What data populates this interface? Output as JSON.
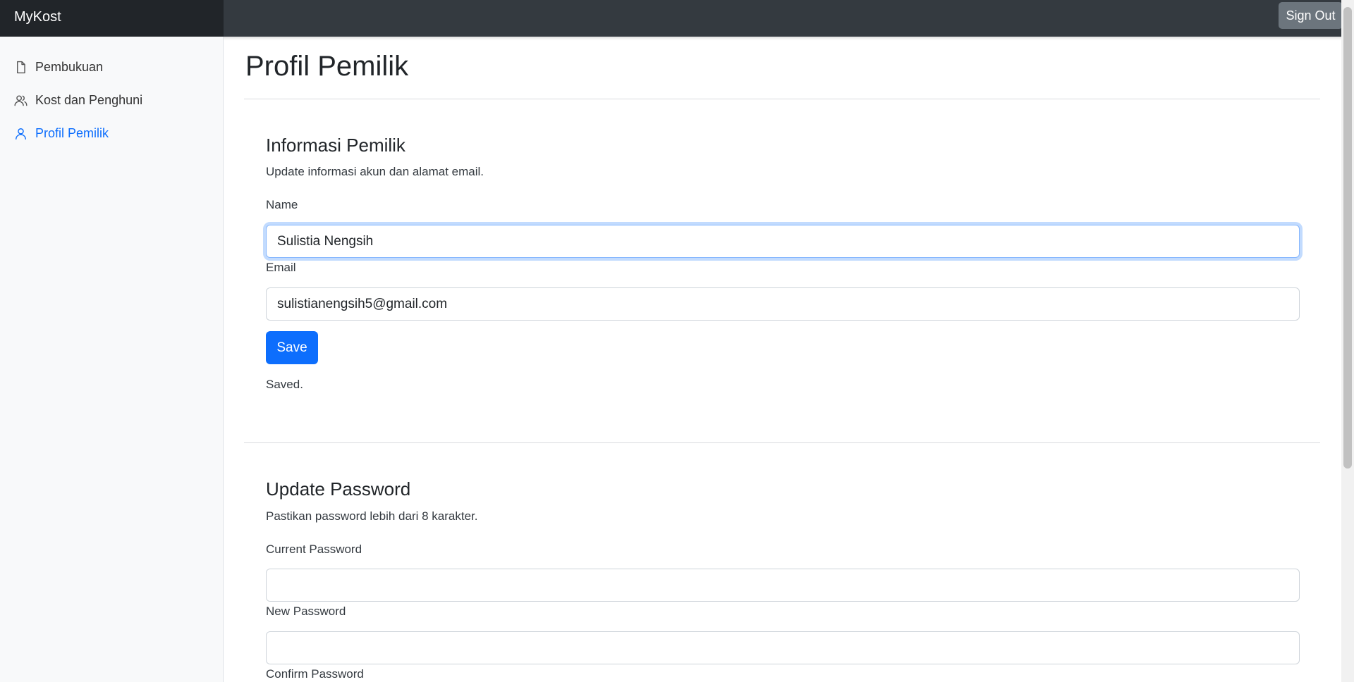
{
  "navbar": {
    "brand": "MyKost",
    "signout_label": "Sign Out"
  },
  "sidebar": {
    "items": [
      {
        "label": "Pembukuan",
        "icon": "file-icon",
        "active": false
      },
      {
        "label": "Kost dan Penghuni",
        "icon": "users-icon",
        "active": false
      },
      {
        "label": "Profil Pemilik",
        "icon": "user-icon",
        "active": true
      }
    ]
  },
  "main": {
    "title": "Profil Pemilik",
    "info": {
      "title": "Informasi Pemilik",
      "description": "Update informasi akun dan alamat email.",
      "name_label": "Name",
      "name_value": "Sulistia Nengsih",
      "email_label": "Email",
      "email_value": "sulistianengsih5@gmail.com",
      "save_label": "Save",
      "saved_message": "Saved."
    },
    "password": {
      "title": "Update Password",
      "description": "Pastikan password lebih dari 8 karakter.",
      "current_label": "Current Password",
      "current_value": "",
      "new_label": "New Password",
      "new_value": "",
      "confirm_label": "Confirm Password"
    }
  },
  "colors": {
    "accent": "#0d6efd",
    "navbar": "#343a40",
    "brand_bg": "#212529",
    "sidebar_bg": "#f8f9fa"
  }
}
